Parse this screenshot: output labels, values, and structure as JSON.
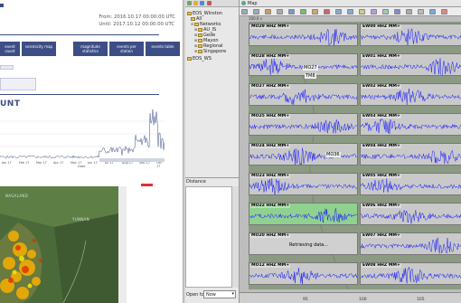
{
  "web": {
    "from_label": "From: 2016.10.17 00:00:00 UTC",
    "until_label": "Until: 2017.10.12 00:00:00 UTC",
    "tabs": [
      "event count",
      "seismicity map",
      "magnitude statistics",
      "events per station",
      "events table"
    ],
    "big_title": "UNT",
    "chart_xlabel": "Date",
    "chart_ticks": [
      "Jan 17",
      "Feb 17",
      "Mar 17",
      "Apr 17",
      "May 17",
      "Jun 17",
      "Jul 17",
      "Aug 17",
      "Sep 17",
      "Oct 17"
    ],
    "map_labels": [
      "NAGALAND",
      "YUNNAN"
    ]
  },
  "tree": {
    "root": "EOS_Winston",
    "items": [
      "All",
      "Networks",
      "AU_IS",
      "Gede",
      "Mayon",
      "Regional",
      "Singapore"
    ],
    "second_root": "EOS_WS"
  },
  "distance_label": "Distance",
  "open_to": {
    "label": "Open to:",
    "value": "Now"
  },
  "map_tab": "Map",
  "traces_left": [
    {
      "label": "MO29 HHZ MM+"
    },
    {
      "label": "MO28 HHZ MM+"
    },
    {
      "label": "MO27 HHZ MM+"
    },
    {
      "label": "MO25 HHZ MM+"
    },
    {
      "label": "MO24 HHZ MM+"
    },
    {
      "label": "MO23 HHZ MM+"
    },
    {
      "label": "MO22 HHZ MM+"
    },
    {
      "label": "MO20 HHZ MM+"
    },
    {
      "label": "MO12 HHZ MM+"
    }
  ],
  "traces_right": [
    {
      "label": "EW00 HHZ MM+"
    },
    {
      "label": "EW01 HHZ MM+"
    },
    {
      "label": "EW02 HHZ MM+"
    },
    {
      "label": "EW03 HHZ MM+"
    },
    {
      "label": "EW04 HHZ MM+"
    },
    {
      "label": "EW05 HHZ MM+"
    },
    {
      "label": "EW06 HHZ MM+"
    },
    {
      "label": "EW07 HHZ MM+"
    },
    {
      "label": "EW08 HHZ MM+"
    }
  ],
  "map_overlay": [
    "MO27",
    "TM8",
    "MO36"
  ],
  "retrieving": "Retrieving data...",
  "axis_ticks": [
    "95",
    "100",
    "105"
  ],
  "colors": {
    "trace": "#1a1aff",
    "tab_bg": "#3d4d85"
  }
}
